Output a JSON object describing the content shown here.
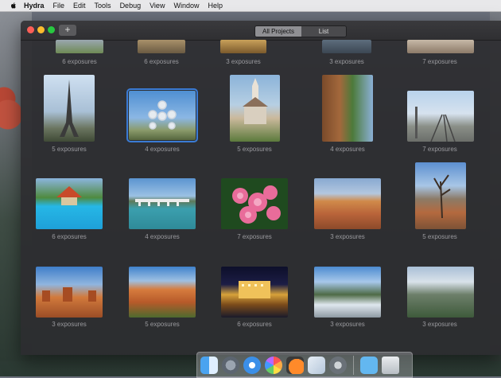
{
  "menubar": {
    "app_name": "Hydra",
    "items": [
      "File",
      "Edit",
      "Tools",
      "Debug",
      "View",
      "Window",
      "Help"
    ]
  },
  "toolbar": {
    "add_label": "+",
    "view_tabs": [
      "All Projects",
      "List"
    ],
    "selected_tab": "All Projects"
  },
  "projects": [
    {
      "caption": "6 exposures"
    },
    {
      "caption": "6 exposures"
    },
    {
      "caption": "3 exposures"
    },
    {
      "caption": "3 exposures"
    },
    {
      "caption": "7 exposures"
    },
    {
      "caption": "5 exposures"
    },
    {
      "caption": "4 exposures"
    },
    {
      "caption": "5 exposures"
    },
    {
      "caption": "4 exposures"
    },
    {
      "caption": "7 exposures"
    },
    {
      "caption": "6 exposures"
    },
    {
      "caption": "4 exposures"
    },
    {
      "caption": "7 exposures"
    },
    {
      "caption": "3 exposures"
    },
    {
      "caption": "5 exposures"
    },
    {
      "caption": "3 exposures"
    },
    {
      "caption": "5 exposures"
    },
    {
      "caption": "6 exposures"
    },
    {
      "caption": "3 exposures"
    },
    {
      "caption": "3 exposures"
    }
  ],
  "dock_icons": [
    "finder-icon",
    "launchpad-icon",
    "safari-icon",
    "photos-icon",
    "hydra-icon",
    "preview-icon",
    "system-preferences-icon",
    "downloads-folder-icon",
    "trash-icon"
  ],
  "colors": {
    "selection": "#3a7bd5"
  }
}
